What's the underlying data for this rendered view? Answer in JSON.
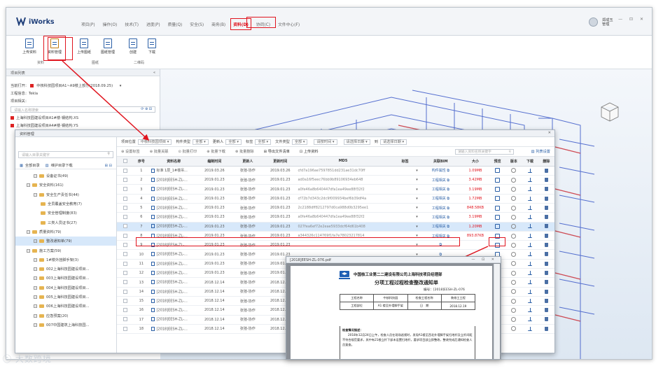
{
  "app": {
    "name": "iWorks"
  },
  "menu": [
    {
      "label": "项目(P)",
      "active": false
    },
    {
      "label": "操作(O)",
      "active": false
    },
    {
      "label": "技术(T)",
      "active": false
    },
    {
      "label": "进度(P)",
      "active": false
    },
    {
      "label": "质量(Q)",
      "active": false
    },
    {
      "label": "安全(S)",
      "active": false
    },
    {
      "label": "商务(B)",
      "active": false
    },
    {
      "label": "资料(D)",
      "active": true
    },
    {
      "label": "协同(C)",
      "active": false
    },
    {
      "label": "文件中心(F)",
      "active": false
    }
  ],
  "user": {
    "name": "郑成玉",
    "role": "管理"
  },
  "window_controls": "—  ⊡  ✕",
  "ribbon": {
    "buttons": [
      {
        "label": "上传资料"
      },
      {
        "label": "资料管理"
      },
      {
        "label": "上传图纸"
      },
      {
        "label": "图纸管理"
      },
      {
        "label": "创建"
      },
      {
        "label": "下载"
      }
    ],
    "groups": [
      "资料",
      "图纸",
      "二维码"
    ]
  },
  "left_panel": {
    "title": "项目列表",
    "collapse": "«",
    "current_open_label": "当前打开：",
    "current_open_value": "中核科技园项目A1~A9楼上部分(2018.09.25)",
    "project_type": "工程信息：Tekla",
    "project_related": "项目相关：",
    "search_placeholder": "请输入名称搜索",
    "items": [
      "上海科技园建设项目A1#楼-钢结构.XS",
      "上海科技园建设项目A4#楼-钢结构.YS"
    ]
  },
  "dialog": {
    "title": "资料管理",
    "close": "✕",
    "left": {
      "search_placeholder": "请输入目录关键字",
      "all_label": "全部目录",
      "download_label": "维护目录下载",
      "tree": [
        {
          "label": "设备证书(49)",
          "level": 2,
          "sel": false
        },
        {
          "label": "安全资料(161)",
          "level": 1,
          "sel": false
        },
        {
          "label": "安全生产责任书(44)",
          "level": 2,
          "sel": false
        },
        {
          "label": "全员覆盖安全教育(7)",
          "level": 3,
          "sel": false
        },
        {
          "label": "安全管理制度(83)",
          "level": 3,
          "sel": false
        },
        {
          "label": "三类人员证书(27)",
          "level": 3,
          "sel": false
        },
        {
          "label": "质量资料(79)",
          "level": 1,
          "sel": false
        },
        {
          "label": "整改通知单(79)",
          "level": 2,
          "sel": true
        },
        {
          "label": "施工方案(59)",
          "level": 1,
          "sel": false
        },
        {
          "label": "1#楼外挂脚手架(3)",
          "level": 2,
          "sel": false
        },
        {
          "label": "002上海科技园建设项目...",
          "level": 2,
          "sel": false
        },
        {
          "label": "003上海科技园建设项目...",
          "level": 2,
          "sel": false
        },
        {
          "label": "004上海科技园建设项目...",
          "level": 2,
          "sel": false
        },
        {
          "label": "005上海科技园建设项目...",
          "level": 2,
          "sel": false
        },
        {
          "label": "006上海科技园建设项目...",
          "level": 2,
          "sel": false
        },
        {
          "label": "应急预案(20)",
          "level": 2,
          "sel": false
        },
        {
          "label": "007中国建筑上海科技园...",
          "level": 2,
          "sel": false
        }
      ]
    },
    "filters": [
      {
        "label": "项目位置",
        "value": "中核科技园项目"
      },
      {
        "label": "构件类型",
        "value": "全部"
      },
      {
        "label": "更新人",
        "value": "全部"
      },
      {
        "label": "标签",
        "value": "全部"
      },
      {
        "label": "文件类型",
        "value": "全部"
      },
      {
        "label": "",
        "value": "请按时间"
      },
      {
        "label": "",
        "value": "请选择日期"
      },
      {
        "label": "到",
        "value": "请选择日期"
      }
    ],
    "toolbar": [
      {
        "label": "⊕ 设置标签",
        "dark": false
      },
      {
        "label": "⊕ 批量关联",
        "dark": false
      },
      {
        "label": "⊙ 批量打印",
        "dark": false
      },
      {
        "label": "⊕ 批量下载",
        "dark": false
      },
      {
        "label": "⊗ 批量删除",
        "dark": false
      },
      {
        "label": "⊞ 导出文件清单",
        "dark": true
      },
      {
        "label": "⊡ 上传资料",
        "dark": true
      }
    ],
    "toolbar_search_placeholder": "请输入资料名称关键字",
    "column_settings": "列表设置",
    "columns": [
      "",
      "序号",
      "资料名称",
      "编制时间",
      "更新人",
      "更新时间",
      "MD5",
      "标签",
      "关联BIM",
      "大小",
      "预览",
      "版本",
      "下载",
      "删除"
    ],
    "rows": [
      [
        "1",
        "标准 1层_1#楼吊...",
        "2019.03.26",
        "张弛-协作",
        "2019.03.26",
        "cfd7a196ae7597851dd231ae31dc70ff",
        "",
        "构件属性",
        "1.09MB"
      ],
      [
        "2",
        "[2018]EESH-ZL-...",
        "2019.01.23",
        "张弛-协作",
        "2019.01.23",
        "ad0a16f5eec76bb9b89106934eb648",
        "",
        "工程相关",
        "3.42MB"
      ],
      [
        "3",
        "[2018]EESH-ZL-...",
        "2019.01.23",
        "张弛-协作",
        "2019.01.23",
        "a0fe46a8b640447dfa1ea49ee88f32f2",
        "",
        "工程相关",
        "3.19MB"
      ],
      [
        "4",
        "[2018]EESH-ZL-...",
        "2019.01.23",
        "张弛-协作",
        "2019.01.23",
        "cf72b7d343c2dc9f009934bef6b39df4a",
        "",
        "工程相关",
        "1.72MB"
      ],
      [
        "5",
        "[2018]EESH-ZL-...",
        "2019.01.23",
        "张弛-协作",
        "2019.01.23",
        "2c2188dff8212797d0ca988d0b3295ee1",
        "",
        "工程相关",
        "848.58KB"
      ],
      [
        "6",
        "[2018]EESH-ZL-...",
        "2019.01.23",
        "张弛-协作",
        "2019.01.23",
        "a0fe46a8b640447dfa1ea49ee88f32f2",
        "",
        "工程相关",
        "3.19MB"
      ],
      [
        "7",
        "[2018]EESH-ZL-...",
        "2019.01.23",
        "张弛-协作",
        "2019.01.23",
        "027fea6ef72e2eae5933dcf64d61b408",
        "",
        "工程相关",
        "1.20MB"
      ],
      [
        "8",
        "[2018]EESH-ZL-...",
        "2019.01.23",
        "张弛-协作",
        "2019.01.23",
        "a344326c114769f1fa7e78023217814",
        "",
        "工程相关",
        "893.87KB"
      ],
      [
        "9",
        "[2018]EESH-ZL-...",
        "2019.01.23",
        "张弛-协作",
        "2019.01.23",
        "",
        "",
        "",
        ""
      ],
      [
        "10",
        "[2018]EESH-ZL-...",
        "2019.01.23",
        "张弛-协作",
        "2019.01.23",
        "",
        "",
        "",
        ""
      ],
      [
        "11",
        "[2018]EESH-ZL-...",
        "2019.01.23",
        "张弛-协作",
        "2019.01.23",
        "",
        "",
        "",
        ""
      ],
      [
        "12",
        "[2018]EESH-ZL-...",
        "2019.01.23",
        "张弛-协作",
        "2019.01.23",
        "",
        "",
        "",
        ""
      ],
      [
        "13",
        "[2018]EESH-ZL-...",
        "2018.12.14",
        "张弛-协作",
        "2018.12.14",
        "",
        "",
        "",
        ""
      ],
      [
        "14",
        "[2018]EESH-ZL-...",
        "2018.12.14",
        "张弛-协作",
        "2018.12.14",
        "",
        "",
        "",
        ""
      ],
      [
        "15",
        "[2018]EESH-ZL-...",
        "2018.12.14",
        "张弛-协作",
        "2018.12.14",
        "",
        "",
        "",
        ""
      ],
      [
        "16",
        "[2018]EESH-ZL-...",
        "2018.12.14",
        "张弛-协作",
        "2018.12.14",
        "",
        "",
        "",
        ""
      ],
      [
        "17",
        "[2018]EESH-ZL-...",
        "2018.12.14",
        "张弛-协作",
        "2018.12.14",
        "",
        "",
        "",
        ""
      ],
      [
        "18",
        "[2018]EESH-ZL-...",
        "2018.12.14",
        "张弛-协作",
        "2018.12.14",
        "",
        "",
        "",
        ""
      ]
    ],
    "highlight_row": 6
  },
  "preview": {
    "title": "[2018]EESH-ZL-076.pdf",
    "controls": "—  ⊡  ✕",
    "company": "中国核工业第二二建设有限公司上海科技项目经理部",
    "doc_title": "分项工程过程检查整改通知单",
    "doc_number": "编号：[2018]EESH-ZL-076",
    "table": [
      [
        "工程名称",
        "中核科技园",
        "检查工程名称",
        "装修工工程"
      ],
      [
        "工程部位",
        "A1 楼至外墙脚手架",
        "日　期",
        "2018.12.19"
      ]
    ],
    "text_head": "检查情况描述：",
    "text_body": "2018年12月24日上午，检查人员在现场巡视时，发现A1楼至西北外墙脚手架扫地杆及立杆间距不符合规范要求，其中有21根立杆下部未设置扫地杆，要求项目部立即整改，整改完成后通知检查人员复查。"
  },
  "watermark": "ⓒ 大数跨境"
}
